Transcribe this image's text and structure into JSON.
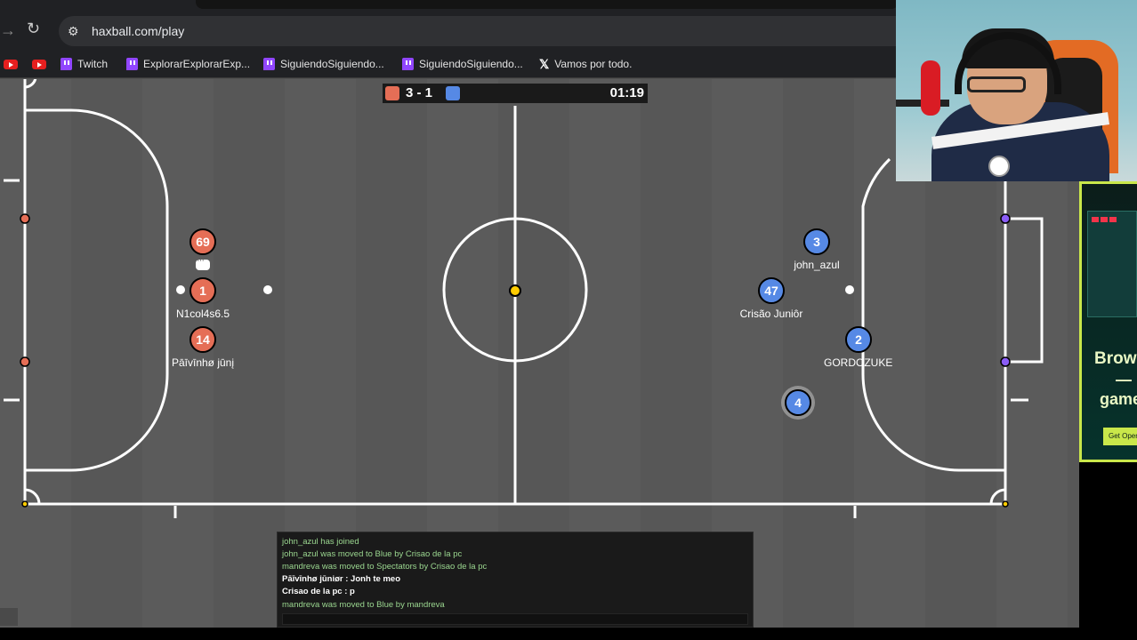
{
  "browser": {
    "url": "haxball.com/play",
    "bookmarks": [
      {
        "type": "youtube",
        "label": ""
      },
      {
        "type": "youtube",
        "label": ""
      },
      {
        "type": "twitch",
        "label": "Twitch"
      },
      {
        "type": "twitch",
        "label": "ExplorarExplorarExp..."
      },
      {
        "type": "twitch",
        "label": "SiguiendoSiguiendo..."
      },
      {
        "type": "twitch",
        "label": "SiguiendoSiguiendo..."
      },
      {
        "type": "x",
        "label": "Vamos por todo."
      }
    ]
  },
  "scoreboard": {
    "red_score": 3,
    "blue_score": 1,
    "score_text": "3 - 1",
    "time": "01:19",
    "colors": {
      "red": "#e56e56",
      "blue": "#5689e5"
    }
  },
  "players": {
    "red": [
      {
        "number": "69",
        "name": ""
      },
      {
        "number": "1",
        "name": "N1col4s6.5"
      },
      {
        "number": "14",
        "name": "Pāīvīnhø jūnį"
      }
    ],
    "blue": [
      {
        "number": "3",
        "name": "john_azul"
      },
      {
        "number": "47",
        "name": "Crisão Juniôr"
      },
      {
        "number": "2",
        "name": "GORDOZUKE"
      },
      {
        "number": "4",
        "name": ""
      }
    ]
  },
  "chat": {
    "lines": [
      {
        "kind": "sys",
        "text": "john_azul has joined"
      },
      {
        "kind": "sys",
        "text": "john_azul was moved to Blue by Crisao de la pc"
      },
      {
        "kind": "sys",
        "text": "mandreva was moved to Spectators by Crisao de la pc"
      },
      {
        "kind": "msg",
        "text": "Pāīvīnhø jūniør : Jonh te meo"
      },
      {
        "kind": "msg",
        "text": "Crisao de la pc : p"
      },
      {
        "kind": "sys",
        "text": "mandreva was moved to Blue by mandreva"
      }
    ],
    "input_value": ""
  },
  "ad": {
    "title": "Brows",
    "dash": "—",
    "subtitle": "game",
    "button": "Get Opera"
  },
  "icons": {
    "forward": "arrow-right-icon",
    "reload": "reload-icon",
    "site_settings": "tune-icon",
    "chat_bubble": "speech-bubble-icon"
  }
}
